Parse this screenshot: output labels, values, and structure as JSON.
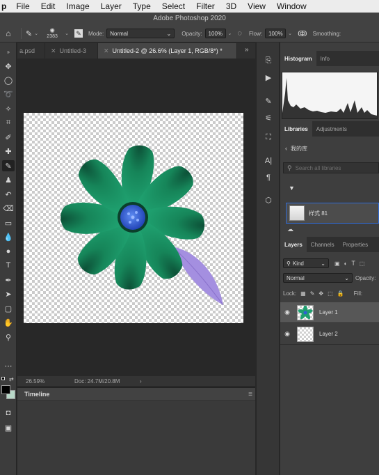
{
  "menu": {
    "app": "p",
    "items": [
      "File",
      "Edit",
      "Image",
      "Layer",
      "Type",
      "Select",
      "Filter",
      "3D",
      "View",
      "Window"
    ]
  },
  "options": {
    "app_title": "Adobe Photoshop 2020",
    "brush_size": "2383",
    "mode_label": "Mode:",
    "mode_value": "Normal",
    "opacity_label": "Opacity:",
    "opacity_value": "100%",
    "flow_label": "Flow:",
    "flow_value": "100%",
    "smoothing_label": "Smoothing:"
  },
  "tabs": [
    {
      "label": "a.psd",
      "active": false
    },
    {
      "label": "Untitled-3",
      "active": false
    },
    {
      "label": "Untitled-2 @ 26.6% (Layer 1, RGB/8*) *",
      "active": true
    }
  ],
  "status": {
    "zoom": "26.59%",
    "doc": "Doc: 24.7M/20.8M",
    "arrow": "›"
  },
  "timeline": {
    "title": "Timeline"
  },
  "histogram_panel": {
    "tabs": [
      "Histogram",
      "Info"
    ]
  },
  "libraries_panel": {
    "tabs": [
      "Libraries",
      "Adjustments"
    ],
    "library_name": "我的库",
    "search_placeholder": "Search all libraries",
    "item_label": "样式 81"
  },
  "layers_panel": {
    "tabs": [
      "Layers",
      "Channels",
      "Properties"
    ],
    "kind_value": "Kind",
    "blend_value": "Normal",
    "opacity_label": "Opacity:",
    "lock_label": "Lock:",
    "fill_label": "Fill:",
    "layers": [
      {
        "name": "Layer 1",
        "selected": true
      },
      {
        "name": "Layer 2",
        "selected": false
      }
    ]
  },
  "colors": {
    "petal": "#1f9f6f",
    "petal_dark": "#0d5a3c",
    "center": "#2f5fd6",
    "leaf": "#a48fe0",
    "foreground": "#000000",
    "background": "#b8d8c8"
  }
}
